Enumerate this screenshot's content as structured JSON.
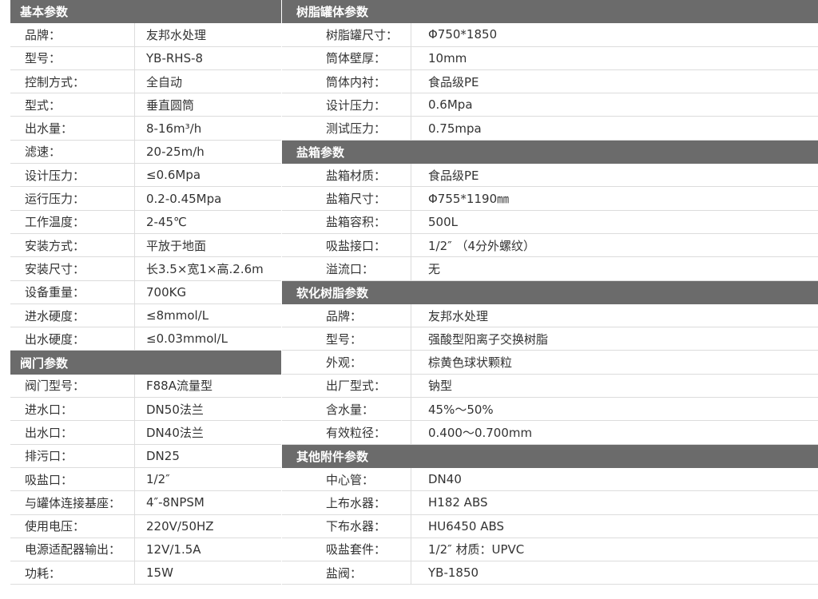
{
  "left": {
    "basic_title": "基本参数",
    "basic_rows": [
      {
        "label": "品牌：",
        "value": "友邦水处理"
      },
      {
        "label": "型号：",
        "value": "YB-RHS-8"
      },
      {
        "label": "控制方式：",
        "value": "全自动"
      },
      {
        "label": "型式：",
        "value": "垂直圆筒"
      },
      {
        "label": "出水量：",
        "value": "8-16m³/h"
      },
      {
        "label": "滤速：",
        "value": "20-25m/h"
      },
      {
        "label": "设计压力：",
        "value": "≤0.6Mpa"
      },
      {
        "label": "运行压力：",
        "value": "0.2-0.45Mpa"
      },
      {
        "label": "工作温度：",
        "value": "2-45℃"
      },
      {
        "label": "安装方式：",
        "value": "平放于地面"
      },
      {
        "label": "安装尺寸：",
        "value": "长3.5×宽1×高.2.6m"
      },
      {
        "label": "设备重量：",
        "value": "700KG"
      },
      {
        "label": "进水硬度：",
        "value": "≤8mmol/L"
      },
      {
        "label": "出水硬度：",
        "value": "≤0.03mmol/L"
      }
    ],
    "valve_title": "阀门参数",
    "valve_rows": [
      {
        "label": "阀门型号：",
        "value": "F88A流量型"
      },
      {
        "label": "进水口：",
        "value": "DN50法兰"
      },
      {
        "label": "出水口：",
        "value": "DN40法兰"
      },
      {
        "label": "排污口：",
        "value": "DN25"
      },
      {
        "label": "吸盐口：",
        "value": "1/2″"
      },
      {
        "label": "与罐体连接基座：",
        "value": "4″-8NPSM"
      },
      {
        "label": "使用电压：",
        "value": "220V/50HZ"
      },
      {
        "label": "电源适配器输出：",
        "value": "12V/1.5A"
      },
      {
        "label": "功耗：",
        "value": "15W"
      }
    ]
  },
  "right": {
    "tank_title": "树脂罐体参数",
    "tank_rows": [
      {
        "label": "树脂罐尺寸：",
        "value": "Φ750*1850"
      },
      {
        "label": "筒体壁厚：",
        "value": "10mm"
      },
      {
        "label": "筒体内衬：",
        "value": "食品级PE"
      },
      {
        "label": "设计压力：",
        "value": "0.6Mpa"
      },
      {
        "label": "测试压力：",
        "value": "0.75mpa"
      }
    ],
    "brine_title": "盐箱参数",
    "brine_rows": [
      {
        "label": "盐箱材质：",
        "value": "食品级PE"
      },
      {
        "label": "盐箱尺寸：",
        "value": "Φ755*1190㎜"
      },
      {
        "label": "盐箱容积：",
        "value": "500L"
      },
      {
        "label": "吸盐接口：",
        "value": "1/2″ （4分外螺纹）"
      },
      {
        "label": "溢流口：",
        "value": "无"
      }
    ],
    "resin_title": "软化树脂参数",
    "resin_rows": [
      {
        "label": "品牌：",
        "value": "友邦水处理"
      },
      {
        "label": "型号：",
        "value": "强酸型阳离子交换树脂"
      },
      {
        "label": "外观：",
        "value": "棕黄色球状颗粒"
      },
      {
        "label": "出厂型式：",
        "value": "钠型"
      },
      {
        "label": "含水量：",
        "value": "45%～50%"
      },
      {
        "label": "有效粒径：",
        "value": "0.400～0.700mm"
      }
    ],
    "other_title": "其他附件参数",
    "other_rows": [
      {
        "label": "中心管：",
        "value": "DN40"
      },
      {
        "label": "上布水器：",
        "value": "H182 ABS"
      },
      {
        "label": "下布水器：",
        "value": "HU6450 ABS"
      },
      {
        "label": "吸盐套件：",
        "value": "1/2″ 材质：UPVC"
      },
      {
        "label": "盐阀：",
        "value": "YB-1850"
      }
    ]
  }
}
